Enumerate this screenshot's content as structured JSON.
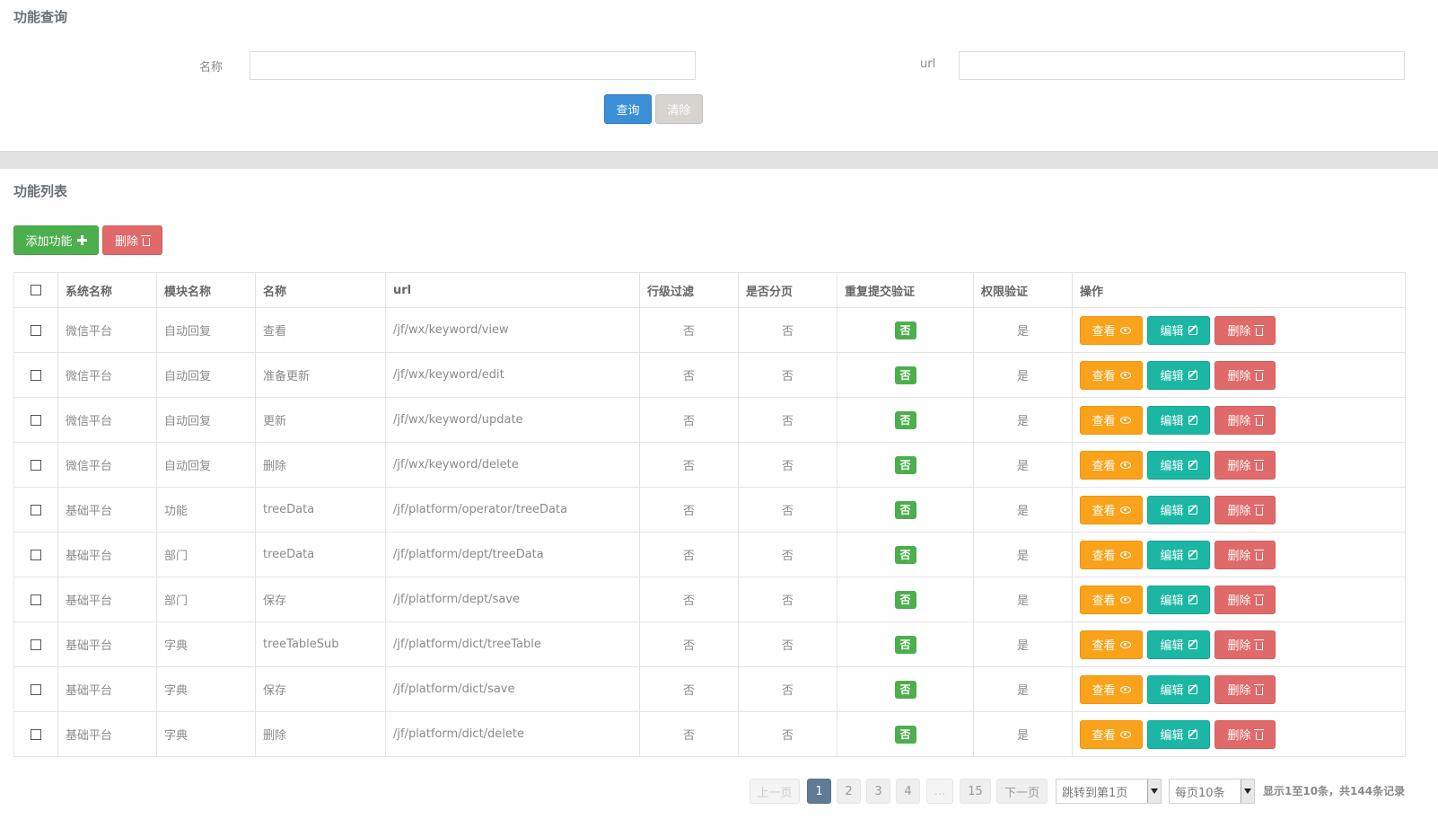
{
  "search": {
    "title": "功能查询",
    "name_label": "名称",
    "name_value": "",
    "url_label": "url",
    "url_value": "",
    "query_button": "查询",
    "clear_button": "清除"
  },
  "list": {
    "title": "功能列表",
    "add_button": "添加功能",
    "delete_button": "删除",
    "columns": [
      "系统名称",
      "模块名称",
      "名称",
      "url",
      "行级过滤",
      "是否分页",
      "重复提交验证",
      "权限验证",
      "操作"
    ],
    "row_actions": {
      "view": "查看",
      "edit": "编辑",
      "delete": "删除"
    },
    "rows": [
      {
        "system": "微信平台",
        "module": "自动回复",
        "name": "查看",
        "url": "/jf/wx/keyword/view",
        "row_filter": "否",
        "paging": "否",
        "resubmit": "否",
        "permission": "是"
      },
      {
        "system": "微信平台",
        "module": "自动回复",
        "name": "准备更新",
        "url": "/jf/wx/keyword/edit",
        "row_filter": "否",
        "paging": "否",
        "resubmit": "否",
        "permission": "是"
      },
      {
        "system": "微信平台",
        "module": "自动回复",
        "name": "更新",
        "url": "/jf/wx/keyword/update",
        "row_filter": "否",
        "paging": "否",
        "resubmit": "否",
        "permission": "是"
      },
      {
        "system": "微信平台",
        "module": "自动回复",
        "name": "删除",
        "url": "/jf/wx/keyword/delete",
        "row_filter": "否",
        "paging": "否",
        "resubmit": "否",
        "permission": "是"
      },
      {
        "system": "基础平台",
        "module": "功能",
        "name": "treeData",
        "url": "/jf/platform/operator/treeData",
        "row_filter": "否",
        "paging": "否",
        "resubmit": "否",
        "permission": "是"
      },
      {
        "system": "基础平台",
        "module": "部门",
        "name": "treeData",
        "url": "/jf/platform/dept/treeData",
        "row_filter": "否",
        "paging": "否",
        "resubmit": "否",
        "permission": "是"
      },
      {
        "system": "基础平台",
        "module": "部门",
        "name": "保存",
        "url": "/jf/platform/dept/save",
        "row_filter": "否",
        "paging": "否",
        "resubmit": "否",
        "permission": "是"
      },
      {
        "system": "基础平台",
        "module": "字典",
        "name": "treeTableSub",
        "url": "/jf/platform/dict/treeTable",
        "row_filter": "否",
        "paging": "否",
        "resubmit": "否",
        "permission": "是"
      },
      {
        "system": "基础平台",
        "module": "字典",
        "name": "保存",
        "url": "/jf/platform/dict/save",
        "row_filter": "否",
        "paging": "否",
        "resubmit": "否",
        "permission": "是"
      },
      {
        "system": "基础平台",
        "module": "字典",
        "name": "删除",
        "url": "/jf/platform/dict/delete",
        "row_filter": "否",
        "paging": "否",
        "resubmit": "否",
        "permission": "是"
      }
    ]
  },
  "pagination": {
    "prev": "上一页",
    "pages": [
      "1",
      "2",
      "3",
      "4"
    ],
    "ellipsis": "...",
    "last": "15",
    "next": "下一页",
    "jump_select": "跳转到第1页",
    "per_page_select": "每页10条",
    "summary": "显示1至10条，共144条记录",
    "current_page": "1"
  },
  "colors": {
    "primary": "#3a8fd6",
    "success": "#4cae4c",
    "danger": "#e06a6a",
    "warning": "#f9a21a",
    "info": "#1cb7a4",
    "active_page": "#5f7b95"
  }
}
